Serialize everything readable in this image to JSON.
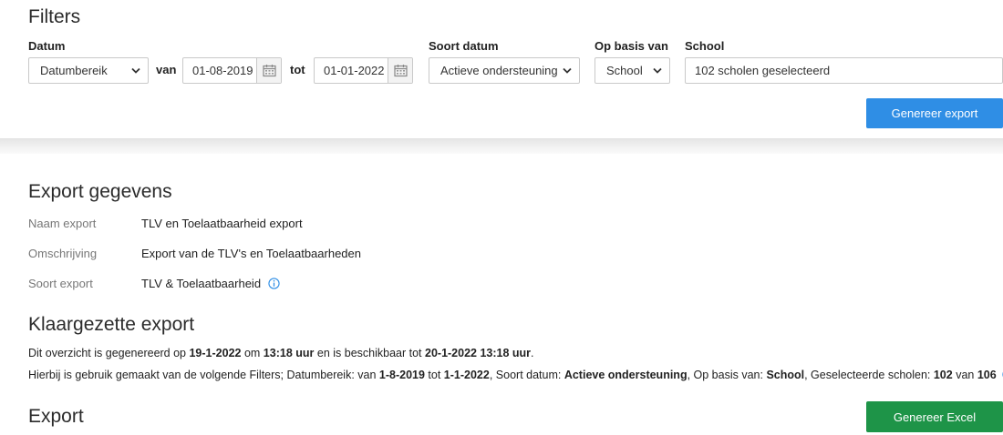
{
  "filters": {
    "title": "Filters",
    "datum_label": "Datum",
    "datum_select": "Datumbereik",
    "van_label": "van",
    "van_date": "01-08-2019",
    "tot_label": "tot",
    "tot_date": "01-01-2022",
    "soort_datum_label": "Soort datum",
    "soort_datum_select": "Actieve ondersteuning",
    "op_basis_label": "Op basis van",
    "op_basis_select": "School",
    "school_label": "School",
    "school_value": "102 scholen geselecteerd",
    "generate_button": "Genereer export"
  },
  "export_details": {
    "title": "Export gegevens",
    "rows": [
      {
        "label": "Naam export",
        "value": "TLV en Toelaatbaarheid export"
      },
      {
        "label": "Omschrijving",
        "value": "Export van de TLV's en Toelaatbaarheden"
      },
      {
        "label": "Soort export",
        "value": "TLV & Toelaatbaarheid"
      }
    ]
  },
  "prepared": {
    "title": "Klaargezette export",
    "line1": {
      "t1": "Dit overzicht is gegenereerd op ",
      "date": "19-1-2022",
      "t2": " om ",
      "time": "13:18 uur",
      "t3": " en is beschikbaar tot ",
      "until": "20-1-2022 13:18 uur",
      "t4": "."
    },
    "line2": {
      "t1": "Hierbij is gebruik gemaakt van de volgende Filters; Datumbereik: van ",
      "from": "1-8-2019",
      "t2": " tot ",
      "to": "1-1-2022",
      "t3": ", Soort datum: ",
      "soort": "Actieve ondersteuning",
      "t4": ", Op basis van: ",
      "basis": "School",
      "t5": ", Geselecteerde scholen: ",
      "selected": "102",
      "t6": " van ",
      "total": "106"
    }
  },
  "export": {
    "title": "Export",
    "excel_button": "Genereer Excel"
  },
  "colors": {
    "primary_button": "#2f8ee5",
    "success_button": "#1e9448",
    "info_icon": "#2f8ee5"
  },
  "icons": {
    "calendar": "calendar-icon",
    "chevron": "chevron-down-icon",
    "info": "info-icon"
  }
}
